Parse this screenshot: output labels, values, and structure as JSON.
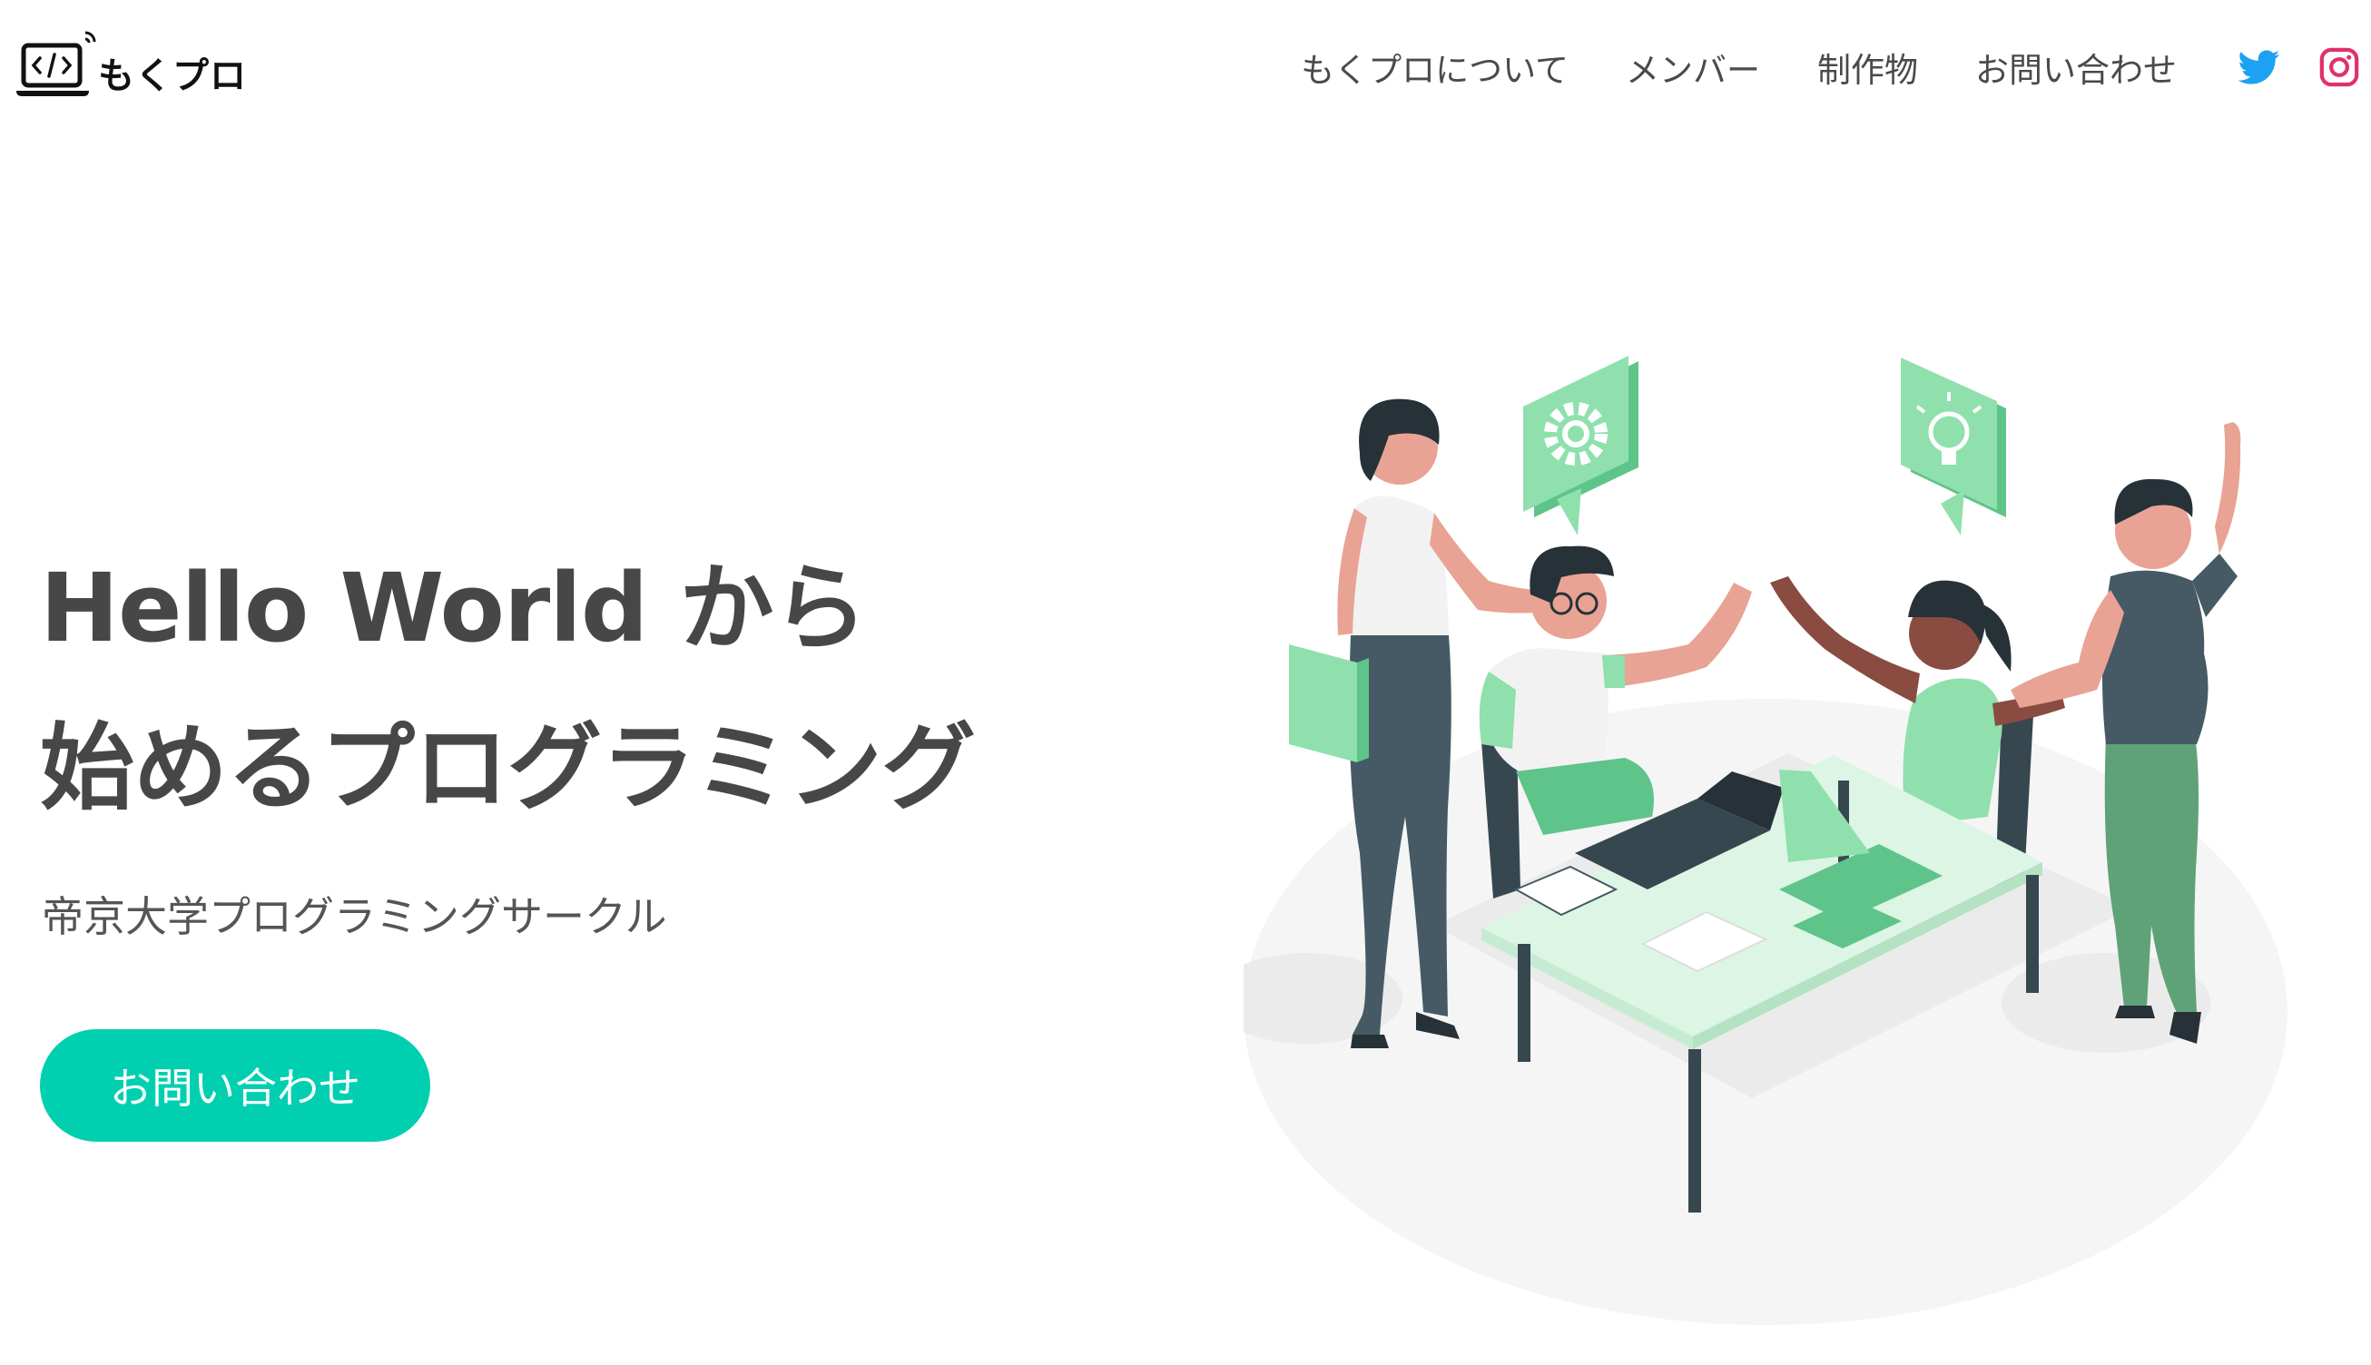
{
  "header": {
    "logo_text": "もくプロ",
    "logo_icon": "laptop-code-icon",
    "nav": [
      {
        "label": "もくプロについて"
      },
      {
        "label": "メンバー"
      },
      {
        "label": "制作物"
      },
      {
        "label": "お問い合わせ"
      }
    ],
    "social": [
      {
        "icon": "twitter-icon",
        "color": "#1da1f2"
      },
      {
        "icon": "instagram-icon",
        "color": "#e1306c"
      }
    ]
  },
  "hero": {
    "title_line1": "Hello World から",
    "title_line2": "始めるプログラミング",
    "subtitle": "帝京大学プログラミングサークル",
    "cta_label": "お問い合わせ"
  },
  "colors": {
    "accent": "#00cfb0",
    "illustration_green": "#7fdba0",
    "text": "#474747"
  }
}
